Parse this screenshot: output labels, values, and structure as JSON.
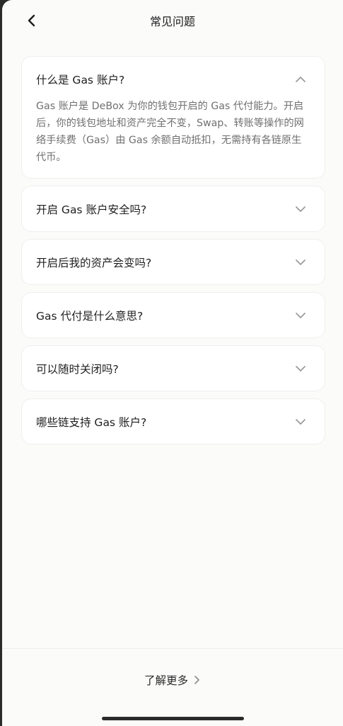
{
  "header": {
    "title": "常见问题"
  },
  "faq": [
    {
      "question": "什么是 Gas 账户?",
      "answer": "Gas 账户是 DeBox 为你的钱包开启的 Gas 代付能力。开启后，你的钱包地址和资产完全不变，Swap、转账等操作的网络手续费（Gas）由 Gas 余额自动抵扣，无需持有各链原生代币。",
      "expanded": true
    },
    {
      "question": "开启 Gas 账户安全吗?",
      "expanded": false
    },
    {
      "question": "开启后我的资产会变吗?",
      "expanded": false
    },
    {
      "question": "Gas 代付是什么意思?",
      "expanded": false
    },
    {
      "question": "可以随时关闭吗?",
      "expanded": false
    },
    {
      "question": "哪些链支持 Gas 账户?",
      "expanded": false
    }
  ],
  "footer": {
    "link_label": "了解更多"
  },
  "colors": {
    "background": "#fbfcfa",
    "card": "#ffffff",
    "text_primary": "#1f1f1f",
    "text_secondary": "#6f716f",
    "icon": "#9a9c9a"
  },
  "icons": {
    "back": "chevron-left-icon",
    "collapse": "chevron-up-icon",
    "expand": "chevron-down-icon",
    "footer": "chevron-right-icon"
  }
}
